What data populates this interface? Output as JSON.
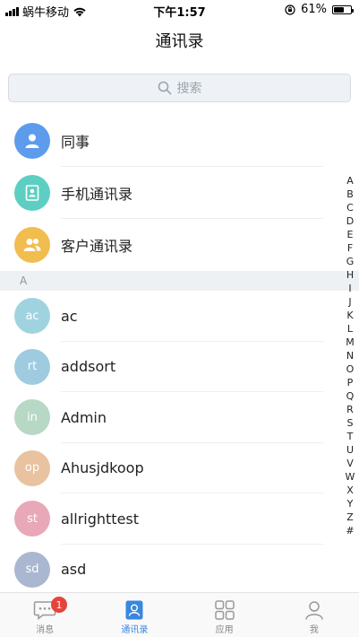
{
  "status_bar": {
    "carrier": "蜗牛移动",
    "time": "下午1:57",
    "battery": "61%",
    "battery_level": 0.61
  },
  "header": {
    "title": "通讯录"
  },
  "search": {
    "placeholder": "搜索",
    "icon": "search-icon"
  },
  "shortcuts": [
    {
      "label": "同事",
      "icon": "person-icon",
      "color": "#5d9cec"
    },
    {
      "label": "手机通讯录",
      "icon": "phonebook-icon",
      "color": "#5dcfc2"
    },
    {
      "label": "客户通讯录",
      "icon": "group-icon",
      "color": "#f1bd4f"
    }
  ],
  "section": {
    "letter": "A"
  },
  "contacts": [
    {
      "initials": "ac",
      "name": "ac",
      "color": "#9fd3e0"
    },
    {
      "initials": "rt",
      "name": "addsort",
      "color": "#9ecbe0"
    },
    {
      "initials": "in",
      "name": "Admin",
      "color": "#b7d8c4"
    },
    {
      "initials": "op",
      "name": "Ahusjdkoop",
      "color": "#e9c2a0"
    },
    {
      "initials": "st",
      "name": "allrighttest",
      "color": "#e8a8b8"
    },
    {
      "initials": "sd",
      "name": "asd",
      "color": "#a9b7d0"
    }
  ],
  "index_letters": [
    "A",
    "B",
    "C",
    "D",
    "E",
    "F",
    "G",
    "H",
    "I",
    "J",
    "K",
    "L",
    "M",
    "N",
    "O",
    "P",
    "Q",
    "R",
    "S",
    "T",
    "U",
    "V",
    "W",
    "X",
    "Y",
    "Z",
    "#"
  ],
  "tab_bar": {
    "tabs": [
      {
        "label": "消息",
        "icon": "chat-icon",
        "badge": "1"
      },
      {
        "label": "通讯录",
        "icon": "contacts-icon"
      },
      {
        "label": "应用",
        "icon": "apps-grid-icon"
      },
      {
        "label": "我",
        "icon": "profile-icon"
      }
    ],
    "active": "通讯录"
  }
}
